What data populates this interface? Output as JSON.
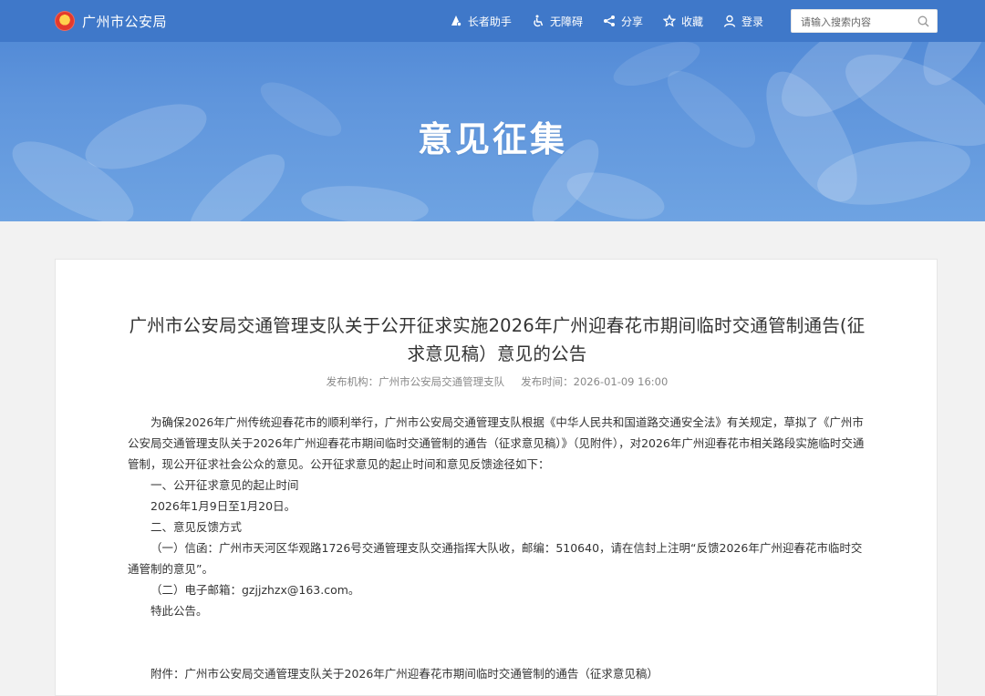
{
  "header": {
    "site_name": "广州市公安局",
    "tools": [
      {
        "icon": "elder-assistant-icon",
        "label": "长者助手"
      },
      {
        "icon": "accessibility-icon",
        "label": "无障碍"
      },
      {
        "icon": "share-icon",
        "label": "分享"
      },
      {
        "icon": "star-icon",
        "label": "收藏"
      },
      {
        "icon": "user-icon",
        "label": "登录"
      }
    ],
    "search_placeholder": "请输入搜索内容"
  },
  "banner": {
    "title": "意见征集"
  },
  "article": {
    "title": "广州市公安局交通管理支队关于公开征求实施2026年广州迎春花市期间临时交通管制通告(征求意见稿）意见的公告",
    "publisher": "发布机构：广州市公安局交通管理支队",
    "publish_time": "发布时间：2026-01-09 16:00",
    "paragraphs": [
      "为确保2026年广州传统迎春花市的顺利举行，广州市公安局交通管理支队根据《中华人民共和国道路交通安全法》有关规定，草拟了《广州市公安局交通管理支队关于2026年广州迎春花市期间临时交通管制的通告（征求意见稿）》（见附件），对2026年广州迎春花市相关路段实施临时交通管制，现公开征求社会公众的意见。公开征求意见的起止时间和意见反馈途径如下：",
      "一、公开征求意见的起止时间",
      "2026年1月9日至1月20日。",
      "二、意见反馈方式",
      "（一）信函：广州市天河区华观路1726号交通管理支队交通指挥大队收，邮编：510640，请在信封上注明“反馈2026年广州迎春花市临时交通管制的意见”。",
      "（二）电子邮箱：gzjjzhzx@163.com。",
      "特此公告。"
    ],
    "attachment": "附件：广州市公安局交通管理支队关于2026年广州迎春花市期间临时交通管制的通告（征求意见稿）"
  },
  "colors": {
    "header_bar": "#3f78c9",
    "banner": "#5f95dc",
    "page_bg": "#f2f2f2"
  }
}
